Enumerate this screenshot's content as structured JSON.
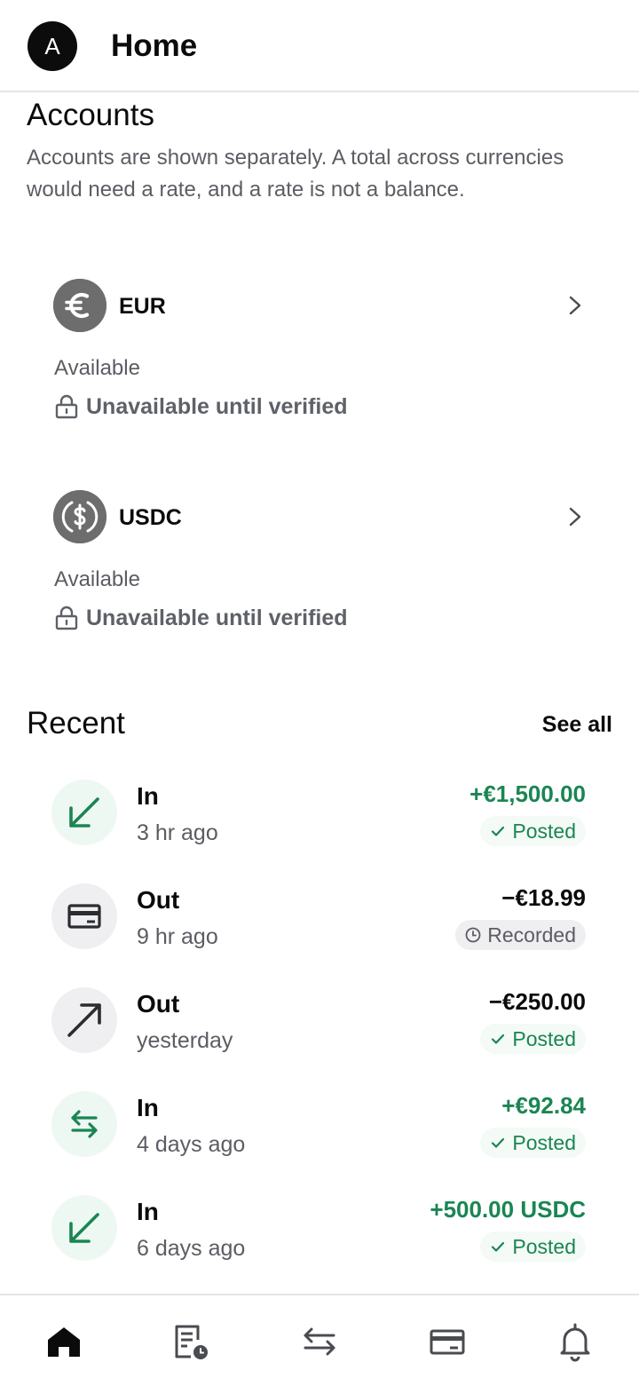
{
  "header": {
    "avatar_initial": "A",
    "title": "Home"
  },
  "accounts": {
    "heading": "Accounts",
    "description": "Accounts are shown separately. A total across currencies would need a rate, and a rate is not a balance.",
    "items": [
      {
        "code": "EUR",
        "icon": "euro-icon",
        "available_label": "Available",
        "status": "Unavailable until verified"
      },
      {
        "code": "USDC",
        "icon": "dollar-icon",
        "available_label": "Available",
        "status": "Unavailable until verified"
      }
    ]
  },
  "recent": {
    "heading": "Recent",
    "see_all": "See all",
    "transactions": [
      {
        "direction": "In",
        "time": "3 hr ago",
        "amount": "+€1,500.00",
        "status": "Posted",
        "icon": "arrow-down-left-icon"
      },
      {
        "direction": "Out",
        "time": "9 hr ago",
        "amount": "−€18.99",
        "status": "Recorded",
        "icon": "card-icon"
      },
      {
        "direction": "Out",
        "time": "yesterday",
        "amount": "−€250.00",
        "status": "Posted",
        "icon": "arrow-up-right-icon"
      },
      {
        "direction": "In",
        "time": "4 days ago",
        "amount": "+€92.84",
        "status": "Posted",
        "icon": "exchange-arrows-icon"
      },
      {
        "direction": "In",
        "time": "6 days ago",
        "amount": "+500.00 USDC",
        "status": "Posted",
        "icon": "arrow-down-left-icon"
      }
    ]
  },
  "bottom_nav": {
    "items": [
      {
        "icon": "home-icon"
      },
      {
        "icon": "activity-icon"
      },
      {
        "icon": "transfer-icon"
      },
      {
        "icon": "card-icon"
      },
      {
        "icon": "bell-icon"
      }
    ]
  },
  "colors": {
    "positive": "#1a8553",
    "muted": "#5b5d63",
    "divider": "#e3e4e7"
  }
}
